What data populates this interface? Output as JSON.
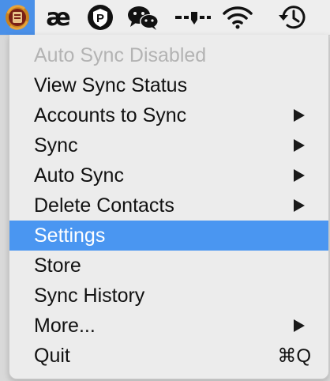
{
  "menubar": {
    "icons": [
      "contacts-sync-app-icon",
      "ae-icon",
      "p-shield-icon",
      "wechat-icon",
      "audio-slider-icon",
      "wifi-icon",
      "time-machine-icon"
    ],
    "ae_glyph": "æ"
  },
  "menu": {
    "items": [
      {
        "label": "Auto Sync Disabled",
        "disabled": true,
        "submenu": false
      },
      {
        "label": "View Sync Status",
        "disabled": false,
        "submenu": false
      },
      {
        "label": "Accounts to Sync",
        "disabled": false,
        "submenu": true
      },
      {
        "label": "Sync",
        "disabled": false,
        "submenu": true
      },
      {
        "label": "Auto Sync",
        "disabled": false,
        "submenu": true
      },
      {
        "label": "Delete Contacts",
        "disabled": false,
        "submenu": true
      },
      {
        "label": "Settings",
        "disabled": false,
        "submenu": false,
        "selected": true
      },
      {
        "label": "Store",
        "disabled": false,
        "submenu": false
      },
      {
        "label": "Sync History",
        "disabled": false,
        "submenu": false
      },
      {
        "label": "More...",
        "disabled": false,
        "submenu": true
      },
      {
        "label": "Quit",
        "disabled": false,
        "submenu": false,
        "shortcut": "⌘Q"
      }
    ]
  },
  "colors": {
    "highlight": "#4a96f1",
    "disabled_text": "#b3b3b3",
    "menu_bg": "#ececec"
  }
}
